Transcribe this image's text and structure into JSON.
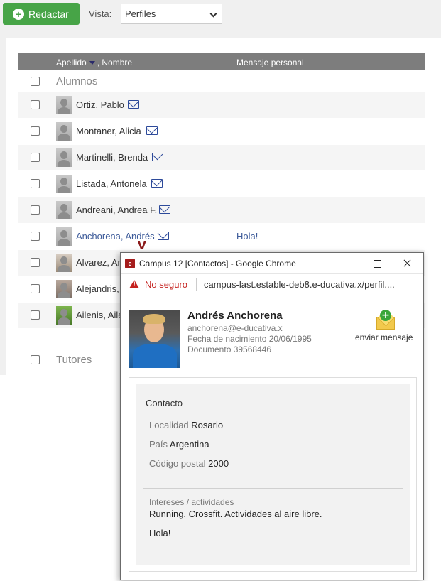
{
  "toolbar": {
    "redactar_label": "Redactar",
    "vista_label": "Vista:",
    "vista_value": "Perfiles"
  },
  "table": {
    "col_name_a": "Apellido",
    "col_name_b": ", Nombre",
    "col_msg": "Mensaje personal"
  },
  "groups": {
    "alumnos": "Alumnos",
    "tutores": "Tutores"
  },
  "rows": [
    {
      "name": "Ortiz, Pablo",
      "msg": ""
    },
    {
      "name": "Montaner, Alicia",
      "msg": ""
    },
    {
      "name": "Martinelli, Brenda",
      "msg": ""
    },
    {
      "name": "Listada, Antonela",
      "msg": ""
    },
    {
      "name": "Andreani, Andrea F.",
      "msg": ""
    },
    {
      "name": "Anchorena, Andrés",
      "msg": "Hola!"
    },
    {
      "name": "Alvarez, An",
      "msg": ""
    },
    {
      "name": "Alejandris,",
      "msg": ""
    },
    {
      "name": "Ailenis, Aile",
      "msg": ""
    }
  ],
  "cursor_char": "V",
  "popup": {
    "app_icon_text": "e",
    "title": "Campus 12 [Contactos] - Google Chrome",
    "security": "No seguro",
    "url": "campus-last.estable-deb8.e-ducativa.x/perfil....",
    "profile": {
      "name": "Andrés Anchorena",
      "email": "anchorena@e-ducativa.x",
      "birth": "Fecha de nacimiento 20/06/1995",
      "document": "Documento 39568446"
    },
    "send_message": "enviar mensaje",
    "contact": {
      "title": "Contacto",
      "localidad_k": "Localidad",
      "localidad_v": "Rosario",
      "pais_k": "País",
      "pais_v": "Argentina",
      "cp_k": "Código postal",
      "cp_v": "2000"
    },
    "interests": {
      "title": "Intereses / actividades",
      "text": "Running. Crossfit. Actividades al aire libre.",
      "message": "Hola!"
    }
  },
  "colors": {
    "accent_green": "#47a447",
    "header_gray": "#7d7d7d",
    "link_blue": "#3c5a99",
    "warning_red": "#c5221f"
  }
}
